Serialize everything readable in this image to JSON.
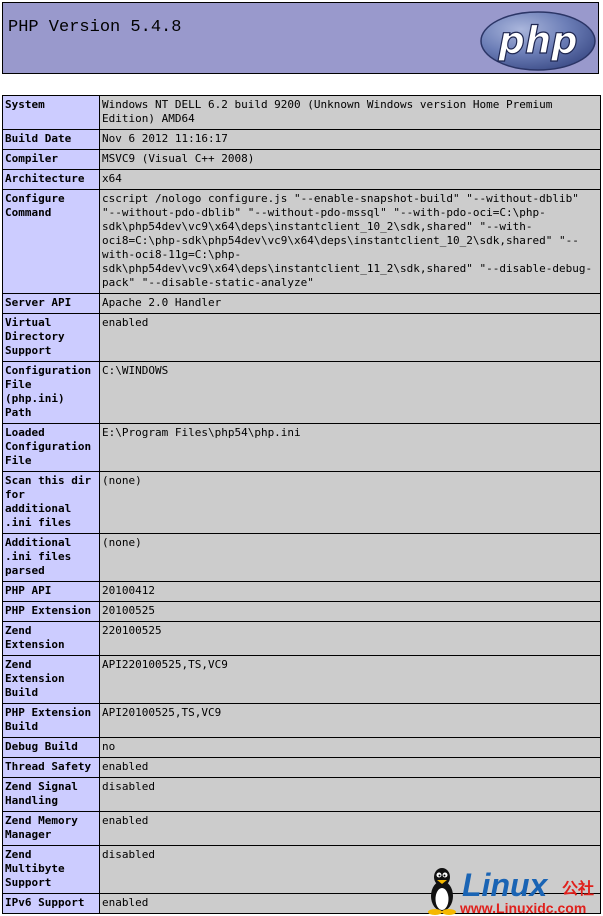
{
  "header": {
    "title": "PHP Version 5.4.8",
    "logo_text": "php"
  },
  "rows": [
    {
      "label": "System",
      "value": "Windows NT DELL 6.2 build 9200 (Unknown Windows version Home Premium Edition) AMD64"
    },
    {
      "label": "Build Date",
      "value": "Nov 6 2012 11:16:17"
    },
    {
      "label": "Compiler",
      "value": "MSVC9 (Visual C++ 2008)"
    },
    {
      "label": "Architecture",
      "value": "x64"
    },
    {
      "label": "Configure Command",
      "value": "cscript /nologo configure.js \"--enable-snapshot-build\" \"--without-dblib\" \"--without-pdo-dblib\" \"--without-pdo-mssql\" \"--with-pdo-oci=C:\\php-sdk\\php54dev\\vc9\\x64\\deps\\instantclient_10_2\\sdk,shared\" \"--with-oci8=C:\\php-sdk\\php54dev\\vc9\\x64\\deps\\instantclient_10_2\\sdk,shared\" \"--with-oci8-11g=C:\\php-sdk\\php54dev\\vc9\\x64\\deps\\instantclient_11_2\\sdk,shared\" \"--disable-debug-pack\" \"--disable-static-analyze\""
    },
    {
      "label": "Server API",
      "value": "Apache 2.0 Handler"
    },
    {
      "label": "Virtual Directory Support",
      "value": "enabled"
    },
    {
      "label": "Configuration File (php.ini) Path",
      "value": "C:\\WINDOWS"
    },
    {
      "label": "Loaded Configuration File",
      "value": "E:\\Program Files\\php54\\php.ini"
    },
    {
      "label": "Scan this dir for additional .ini files",
      "value": "(none)"
    },
    {
      "label": "Additional .ini files parsed",
      "value": "(none)"
    },
    {
      "label": "PHP API",
      "value": "20100412"
    },
    {
      "label": "PHP Extension",
      "value": "20100525"
    },
    {
      "label": "Zend Extension",
      "value": "220100525"
    },
    {
      "label": "Zend Extension Build",
      "value": "API220100525,TS,VC9"
    },
    {
      "label": "PHP Extension Build",
      "value": "API20100525,TS,VC9"
    },
    {
      "label": "Debug Build",
      "value": "no"
    },
    {
      "label": "Thread Safety",
      "value": "enabled"
    },
    {
      "label": "Zend Signal Handling",
      "value": "disabled"
    },
    {
      "label": "Zend Memory Manager",
      "value": "enabled"
    },
    {
      "label": "Zend Multibyte Support",
      "value": "disabled"
    },
    {
      "label": "IPv6 Support",
      "value": "enabled"
    }
  ],
  "watermark": {
    "brand": "Linux",
    "suffix": "公社",
    "url": "www.Linuxidc.com"
  },
  "colors": {
    "header_bg": "#9999cc",
    "label_bg": "#ccccff",
    "value_bg": "#cccccc",
    "logo_bg": "#6c7eb7",
    "watermark_blue": "#1a64b4",
    "watermark_red": "#e0201c"
  }
}
